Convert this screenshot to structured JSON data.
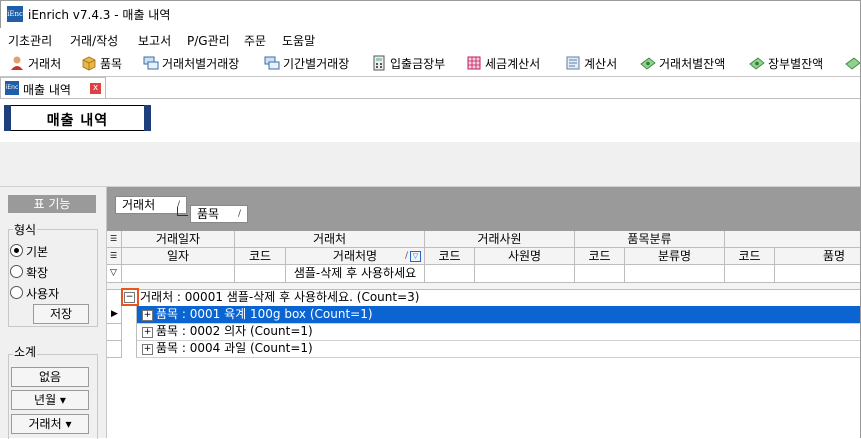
{
  "window": {
    "logo_text": "iEnc",
    "title": "iEnrich v7.4.3 - 매출 내역"
  },
  "menu": [
    "기초관리",
    "거래/작성",
    "보고서",
    "P/G관리",
    "주문",
    "도움말"
  ],
  "toolbar": [
    {
      "label": "거래처",
      "icon": "person-icon",
      "color": "#c0392b"
    },
    {
      "label": "품목",
      "icon": "box-icon",
      "color": "#d4a017"
    },
    {
      "label": "거래처별거래장",
      "icon": "ledger-icon",
      "color": "#3a6ea5"
    },
    {
      "label": "기간별거래장",
      "icon": "ledger-icon",
      "color": "#3a6ea5"
    },
    {
      "label": "입출금장부",
      "icon": "calculator-icon",
      "color": "#555555"
    },
    {
      "label": "세금계산서",
      "icon": "invoice-icon",
      "color": "#c2185b"
    },
    {
      "label": "계산서",
      "icon": "document-icon",
      "color": "#5b7fa8"
    },
    {
      "label": "거래처별잔액",
      "icon": "money-icon",
      "color": "#4caf50"
    },
    {
      "label": "장부별잔액",
      "icon": "money-icon",
      "color": "#4caf50"
    }
  ],
  "doc_tab": {
    "label": "매출 내역",
    "close": "x"
  },
  "page_title": "매출 내역",
  "left_panel": {
    "header": "표 기능",
    "format_label": "형식",
    "format_options": [
      "기본",
      "확장",
      "사용자"
    ],
    "format_selected": "기본",
    "save_button": "저장",
    "subtotal_label": "소계",
    "subtotal_buttons": [
      "없음",
      "년월 ▾",
      "거래처 ▾"
    ]
  },
  "group_chips": [
    {
      "label": "거래처",
      "sort": "/"
    },
    {
      "label": "품목",
      "sort": "/"
    }
  ],
  "grid": {
    "band_headers": [
      "거래일자",
      "거래처",
      "거래사원",
      "품목분류",
      ""
    ],
    "column_headers": [
      "일자",
      "코드",
      "거래처명",
      "코드",
      "사원명",
      "코드",
      "분류명",
      "코드",
      "품명"
    ],
    "filter_value": "샘플-삭제 후 사용하세요",
    "group_row": "거래처 : 00001 샘플-삭제 후 사용하세요. (Count=3)",
    "sub_rows": [
      "품목 : 0001 육계 100g box (Count=1)",
      "품목 : 0002 의자   (Count=1)",
      "품목 : 0004 과일   (Count=1)"
    ],
    "selected_row_color": "#0a64d2"
  }
}
